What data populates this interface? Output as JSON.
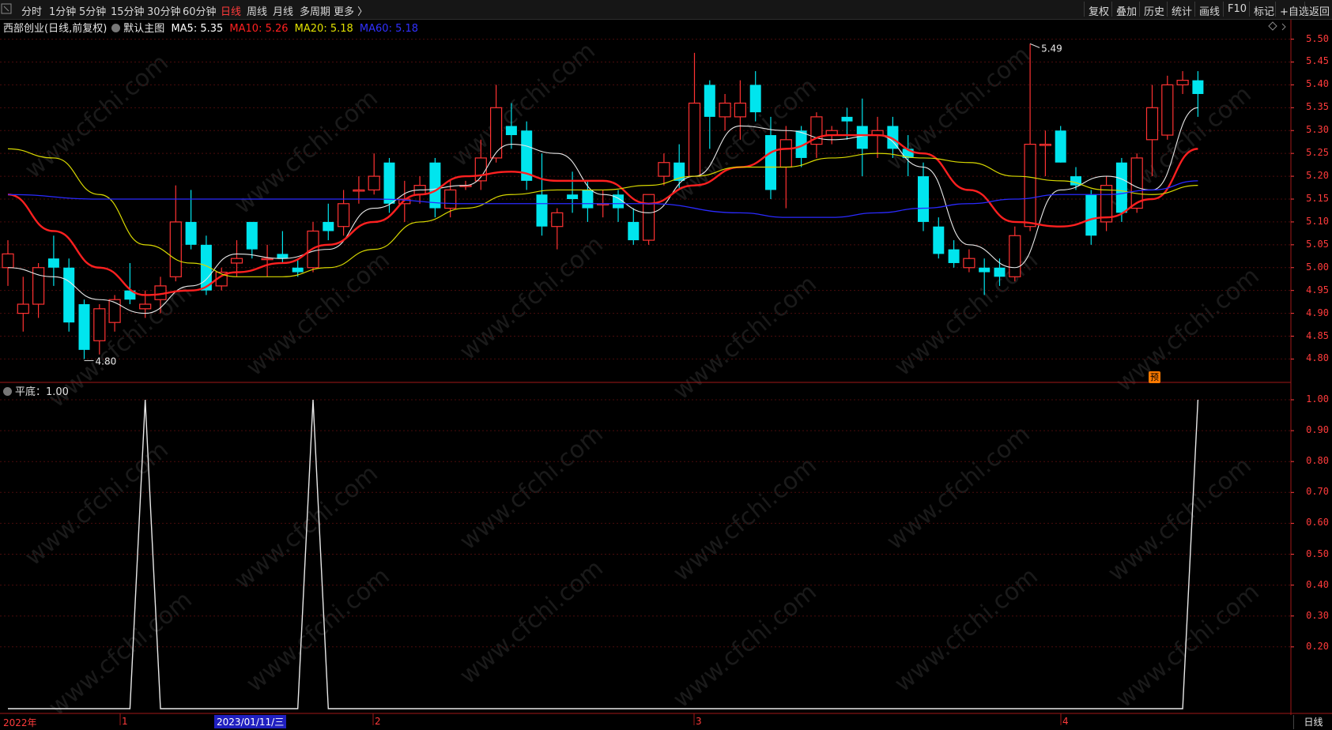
{
  "toolbar": {
    "periods": [
      "分时",
      "1分钟",
      "5分钟",
      "15分钟",
      "30分钟",
      "60分钟",
      "日线",
      "周线",
      "月线",
      "多周期",
      "更多 〉"
    ],
    "active_period": "日线",
    "right_buttons": [
      "复权",
      "叠加",
      "历史",
      "统计",
      "画线",
      "F10",
      "标记",
      "+自选",
      "返回"
    ]
  },
  "stock": {
    "name": "西部创业(日线,前复权)",
    "main_label": "默认主图",
    "ma5": "MA5: 5.35",
    "ma10": "MA10: 5.26",
    "ma20": "MA20: 5.18",
    "ma60": "MA60: 5.18"
  },
  "indicator": {
    "label": "平底：1.00"
  },
  "annotations": {
    "high": "5.49",
    "low": "4.80",
    "yu_badge": "预"
  },
  "axis": {
    "price_ticks": [
      "5.50",
      "5.45",
      "5.40",
      "5.35",
      "5.30",
      "5.25",
      "5.20",
      "5.15",
      "5.10",
      "5.05",
      "5.00",
      "4.95",
      "4.90",
      "4.85",
      "4.80"
    ],
    "ind_ticks": [
      "1.00",
      "0.90",
      "0.80",
      "0.70",
      "0.60",
      "0.50",
      "0.40",
      "0.30",
      "0.20"
    ]
  },
  "dates": {
    "year": "2022年",
    "months": [
      "1",
      "2",
      "3",
      "4"
    ],
    "selected": "2023/01/11/三",
    "period_button": "日线"
  },
  "watermark": "www.cfchi.com",
  "colors": {
    "up": "#ff3232",
    "down": "#00e5ee",
    "ma5": "#ffffff",
    "ma10": "#ff2020",
    "ma20": "#e0e000",
    "ma60": "#2020ff",
    "axis": "#ff3b3b"
  },
  "chart_data": {
    "type": "candlestick",
    "price_range": [
      4.78,
      5.52
    ],
    "candles": [
      [
        5.0,
        5.03,
        5.06,
        4.96
      ],
      [
        4.9,
        4.92,
        4.98,
        4.86
      ],
      [
        4.92,
        5.0,
        5.01,
        4.89
      ],
      [
        5.02,
        5.0,
        5.07,
        4.96
      ],
      [
        5.0,
        4.88,
        5.02,
        4.86
      ],
      [
        4.92,
        4.82,
        4.93,
        4.8
      ],
      [
        4.84,
        4.91,
        4.92,
        4.81
      ],
      [
        4.88,
        4.93,
        4.94,
        4.86
      ],
      [
        4.95,
        4.93,
        5.01,
        4.92
      ],
      [
        4.91,
        4.92,
        4.95,
        4.89
      ],
      [
        4.93,
        4.96,
        4.98,
        4.9
      ],
      [
        4.98,
        5.1,
        5.18,
        4.97
      ],
      [
        5.1,
        5.05,
        5.17,
        5.04
      ],
      [
        5.05,
        4.95,
        5.07,
        4.94
      ],
      [
        4.96,
        4.99,
        5.0,
        4.95
      ],
      [
        5.01,
        5.02,
        5.06,
        4.98
      ],
      [
        5.1,
        5.04,
        5.1,
        5.02
      ],
      [
        5.02,
        5.02,
        5.05,
        4.98
      ],
      [
        5.03,
        5.02,
        5.08,
        5.01
      ],
      [
        5.0,
        4.99,
        5.02,
        4.98
      ],
      [
        5.0,
        5.08,
        5.1,
        4.99
      ],
      [
        5.1,
        5.08,
        5.14,
        5.06
      ],
      [
        5.09,
        5.14,
        5.17,
        5.07
      ],
      [
        5.17,
        5.17,
        5.2,
        5.14
      ],
      [
        5.17,
        5.2,
        5.25,
        5.16
      ],
      [
        5.23,
        5.14,
        5.24,
        5.12
      ],
      [
        5.14,
        5.15,
        5.19,
        5.1
      ],
      [
        5.16,
        5.18,
        5.2,
        5.14
      ],
      [
        5.23,
        5.13,
        5.24,
        5.11
      ],
      [
        5.13,
        5.17,
        5.19,
        5.11
      ],
      [
        5.18,
        5.18,
        5.19,
        5.17
      ],
      [
        5.19,
        5.24,
        5.28,
        5.17
      ],
      [
        5.24,
        5.35,
        5.4,
        5.23
      ],
      [
        5.31,
        5.29,
        5.36,
        5.26
      ],
      [
        5.3,
        5.19,
        5.32,
        5.17
      ],
      [
        5.16,
        5.09,
        5.25,
        5.07
      ],
      [
        5.09,
        5.12,
        5.13,
        5.04
      ],
      [
        5.16,
        5.15,
        5.21,
        5.12
      ],
      [
        5.17,
        5.13,
        5.19,
        5.1
      ],
      [
        5.14,
        5.14,
        5.17,
        5.11
      ],
      [
        5.16,
        5.13,
        5.17,
        5.1
      ],
      [
        5.1,
        5.06,
        5.13,
        5.05
      ],
      [
        5.06,
        5.16,
        5.16,
        5.05
      ],
      [
        5.2,
        5.23,
        5.25,
        5.18
      ],
      [
        5.23,
        5.19,
        5.27,
        5.17
      ],
      [
        5.2,
        5.36,
        5.47,
        5.2
      ],
      [
        5.4,
        5.33,
        5.41,
        5.26
      ],
      [
        5.33,
        5.36,
        5.38,
        5.3
      ],
      [
        5.33,
        5.36,
        5.41,
        5.28
      ],
      [
        5.4,
        5.34,
        5.43,
        5.32
      ],
      [
        5.29,
        5.17,
        5.33,
        5.15
      ],
      [
        5.22,
        5.28,
        5.31,
        5.13
      ],
      [
        5.3,
        5.24,
        5.31,
        5.22
      ],
      [
        5.27,
        5.33,
        5.34,
        5.24
      ],
      [
        5.29,
        5.3,
        5.31,
        5.27
      ],
      [
        5.33,
        5.32,
        5.35,
        5.28
      ],
      [
        5.31,
        5.26,
        5.37,
        5.2
      ],
      [
        5.29,
        5.3,
        5.33,
        5.24
      ],
      [
        5.31,
        5.26,
        5.33,
        5.24
      ],
      [
        5.26,
        5.24,
        5.29,
        5.2
      ],
      [
        5.2,
        5.1,
        5.23,
        5.08
      ],
      [
        5.09,
        5.03,
        5.11,
        5.02
      ],
      [
        5.04,
        5.01,
        5.06,
        5.0
      ],
      [
        5.0,
        5.02,
        5.04,
        4.99
      ],
      [
        5.0,
        4.99,
        5.02,
        4.94
      ],
      [
        5.0,
        4.98,
        5.02,
        4.96
      ],
      [
        4.98,
        5.07,
        5.09,
        4.97
      ],
      [
        5.09,
        5.27,
        5.49,
        5.08
      ],
      [
        5.27,
        5.27,
        5.3,
        5.2
      ],
      [
        5.3,
        5.23,
        5.31,
        5.23
      ],
      [
        5.2,
        5.18,
        5.22,
        5.17
      ],
      [
        5.16,
        5.07,
        5.17,
        5.05
      ],
      [
        5.1,
        5.18,
        5.2,
        5.08
      ],
      [
        5.23,
        5.12,
        5.24,
        5.1
      ],
      [
        5.13,
        5.24,
        5.25,
        5.12
      ],
      [
        5.28,
        5.35,
        5.4,
        5.2
      ],
      [
        5.29,
        5.4,
        5.42,
        5.28
      ],
      [
        5.4,
        5.41,
        5.43,
        5.38
      ],
      [
        5.41,
        5.38,
        5.43,
        5.33
      ]
    ],
    "ma": {
      "ma5": [
        [
          0,
          5.0
        ],
        [
          3,
          4.98
        ],
        [
          6,
          4.93
        ],
        [
          9,
          4.9
        ],
        [
          12,
          4.96
        ],
        [
          15,
          5.03
        ],
        [
          18,
          5.02
        ],
        [
          21,
          5.04
        ],
        [
          24,
          5.13
        ],
        [
          27,
          5.17
        ],
        [
          30,
          5.18
        ],
        [
          33,
          5.27
        ],
        [
          36,
          5.25
        ],
        [
          39,
          5.16
        ],
        [
          42,
          5.12
        ],
        [
          45,
          5.2
        ],
        [
          48,
          5.31
        ],
        [
          51,
          5.3
        ],
        [
          54,
          5.28
        ],
        [
          57,
          5.29
        ],
        [
          60,
          5.22
        ],
        [
          63,
          5.05
        ],
        [
          66,
          5.0
        ],
        [
          69,
          5.17
        ],
        [
          72,
          5.2
        ],
        [
          75,
          5.17
        ],
        [
          78,
          5.35
        ]
      ],
      "ma10": [
        [
          0,
          5.16
        ],
        [
          3,
          5.08
        ],
        [
          6,
          5.0
        ],
        [
          9,
          4.94
        ],
        [
          12,
          4.95
        ],
        [
          15,
          4.99
        ],
        [
          18,
          5.01
        ],
        [
          21,
          5.05
        ],
        [
          24,
          5.1
        ],
        [
          27,
          5.16
        ],
        [
          30,
          5.2
        ],
        [
          33,
          5.21
        ],
        [
          36,
          5.19
        ],
        [
          39,
          5.19
        ],
        [
          42,
          5.14
        ],
        [
          45,
          5.18
        ],
        [
          48,
          5.22
        ],
        [
          51,
          5.26
        ],
        [
          54,
          5.29
        ],
        [
          57,
          5.29
        ],
        [
          60,
          5.25
        ],
        [
          63,
          5.17
        ],
        [
          66,
          5.1
        ],
        [
          69,
          5.09
        ],
        [
          72,
          5.11
        ],
        [
          75,
          5.15
        ],
        [
          78,
          5.26
        ]
      ],
      "ma20": [
        [
          0,
          5.26
        ],
        [
          3,
          5.24
        ],
        [
          6,
          5.16
        ],
        [
          9,
          5.05
        ],
        [
          12,
          5.01
        ],
        [
          15,
          4.98
        ],
        [
          18,
          4.98
        ],
        [
          21,
          5.0
        ],
        [
          24,
          5.04
        ],
        [
          27,
          5.1
        ],
        [
          30,
          5.13
        ],
        [
          33,
          5.16
        ],
        [
          36,
          5.17
        ],
        [
          39,
          5.17
        ],
        [
          42,
          5.18
        ],
        [
          45,
          5.2
        ],
        [
          48,
          5.22
        ],
        [
          51,
          5.22
        ],
        [
          54,
          5.24
        ],
        [
          57,
          5.25
        ],
        [
          60,
          5.24
        ],
        [
          63,
          5.23
        ],
        [
          66,
          5.2
        ],
        [
          69,
          5.19
        ],
        [
          72,
          5.17
        ],
        [
          75,
          5.16
        ],
        [
          78,
          5.18
        ]
      ],
      "ma60": [
        [
          0,
          5.16
        ],
        [
          6,
          5.15
        ],
        [
          12,
          5.15
        ],
        [
          18,
          5.15
        ],
        [
          24,
          5.15
        ],
        [
          30,
          5.14
        ],
        [
          36,
          5.14
        ],
        [
          42,
          5.14
        ],
        [
          48,
          5.12
        ],
        [
          51,
          5.11
        ],
        [
          54,
          5.11
        ],
        [
          57,
          5.12
        ],
        [
          60,
          5.13
        ],
        [
          63,
          5.14
        ],
        [
          66,
          5.15
        ],
        [
          69,
          5.16
        ],
        [
          72,
          5.16
        ],
        [
          75,
          5.17
        ],
        [
          78,
          5.19
        ]
      ]
    },
    "indicator": {
      "name": "平底",
      "values": [
        0,
        0,
        0,
        0,
        0,
        0,
        0,
        0,
        0,
        1,
        0,
        0,
        0,
        0,
        0,
        0,
        0,
        0,
        0,
        0,
        1,
        0,
        0,
        0,
        0,
        0,
        0,
        0,
        0,
        0,
        0,
        0,
        0,
        0,
        0,
        0,
        0,
        0,
        0,
        0,
        0,
        0,
        0,
        0,
        0,
        0,
        0,
        0,
        0,
        0,
        0,
        0,
        0,
        0,
        0,
        0,
        0,
        0,
        0,
        0,
        0,
        0,
        0,
        0,
        0,
        0,
        0,
        0,
        0,
        0,
        0,
        0,
        0,
        0,
        0,
        0,
        0,
        0,
        1
      ],
      "ylim": [
        0,
        1.0
      ]
    }
  }
}
